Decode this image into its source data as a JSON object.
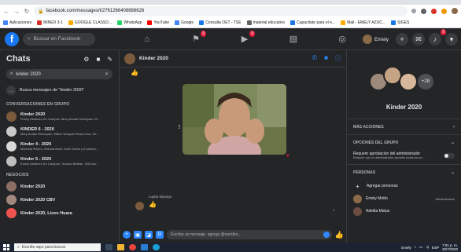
{
  "browser": {
    "url": "facebook.com/messages/t/2761266408688626"
  },
  "bookmarks": [
    {
      "label": "Aplicaciones",
      "color": "#4285f4"
    },
    {
      "label": "MINED 3-1",
      "color": "#d93025"
    },
    {
      "label": "GOOGLE CLASSO...",
      "color": "#f9ab00"
    },
    {
      "label": "WhatsApp",
      "color": "#25d366"
    },
    {
      "label": "YouTube",
      "color": "#ff0000"
    },
    {
      "label": "Google",
      "color": "#4285f4"
    },
    {
      "label": "Consulta OET - TSE",
      "color": "#1a73e8"
    },
    {
      "label": "material educativo",
      "color": "#5f6368"
    },
    {
      "label": "Capacitate para el e...",
      "color": "#1a73e8"
    },
    {
      "label": "Mail - EMELY AZUC...",
      "color": "#f9ab00"
    },
    {
      "label": "SIGES",
      "color": "#1a73e8"
    }
  ],
  "fb": {
    "search_placeholder": "Buscar en Facebook",
    "user_name": "Emely",
    "nav_badges": [
      "9",
      "9"
    ],
    "bell_badge": "9"
  },
  "sidebar": {
    "title": "Chats",
    "search_value": "kinder 2020",
    "message_search": "Busca mensajes de \"kinder 2020\"",
    "section_groups": "CONVERSACIONES EN GRUPO",
    "section_businesses": "NEGOCIOS",
    "group_chats": [
      {
        "name": "Kinder 2020",
        "sub": "Emely Martinez De Campos, Mery Azalia Henriquez, M...",
        "color": "#7b5a3e"
      },
      {
        "name": "KINDER 6 - 2020",
        "sub": "Mery Azalia Henriquez, Milton Vasquez Rosa Cruz, Ke...",
        "color": "#c9c9c9"
      },
      {
        "name": "Kinder 4 - 2020",
        "sub": "Maricela Reyes, Victoria Amel, Gabi Torres y 8 person...",
        "color": "#d8d8d8"
      },
      {
        "name": "Kinder 5 - 2020",
        "sub": "Emely Martinez De Campos, Yessica Beltran, Tati Dav...",
        "color": "#bdbdbd"
      }
    ],
    "business_chats": [
      {
        "name": "Kinder 2020",
        "color": "#8d6e63"
      },
      {
        "name": "Kinder 2020 CBV",
        "color": "#a1887f"
      },
      {
        "name": "Kinder 2020, Liceo Huara",
        "color": "#ef5350"
      }
    ]
  },
  "conversation": {
    "title": "Kinder 2020",
    "sender_name": "Lupita Mijango",
    "input_placeholder": "Escribe un mensaje, agrega @nombre..."
  },
  "details": {
    "group_name": "Kinder 2020",
    "more_count": "+28",
    "more_actions": "MÁS ACCIONES",
    "group_options": "OPCIONES DEL GRUPO",
    "approval_title": "Requerir aprobación del administrador",
    "approval_sub": "Requerir que un administrador apruebe todas las so...",
    "people_section": "PERSONAS",
    "add_people": "Agregar personas",
    "people": [
      {
        "name": "Emely Motto",
        "role": "Administrador",
        "color": "#8a6a4a"
      },
      {
        "name": "Adelita Matus",
        "role": "",
        "color": "#6d4c41"
      }
    ]
  },
  "taskbar": {
    "search_placeholder": "Escribe aquí para buscar",
    "tray_user": "Emely",
    "lang": "ESP",
    "time": "7:01 p. m.",
    "date": "20/7/2020"
  }
}
